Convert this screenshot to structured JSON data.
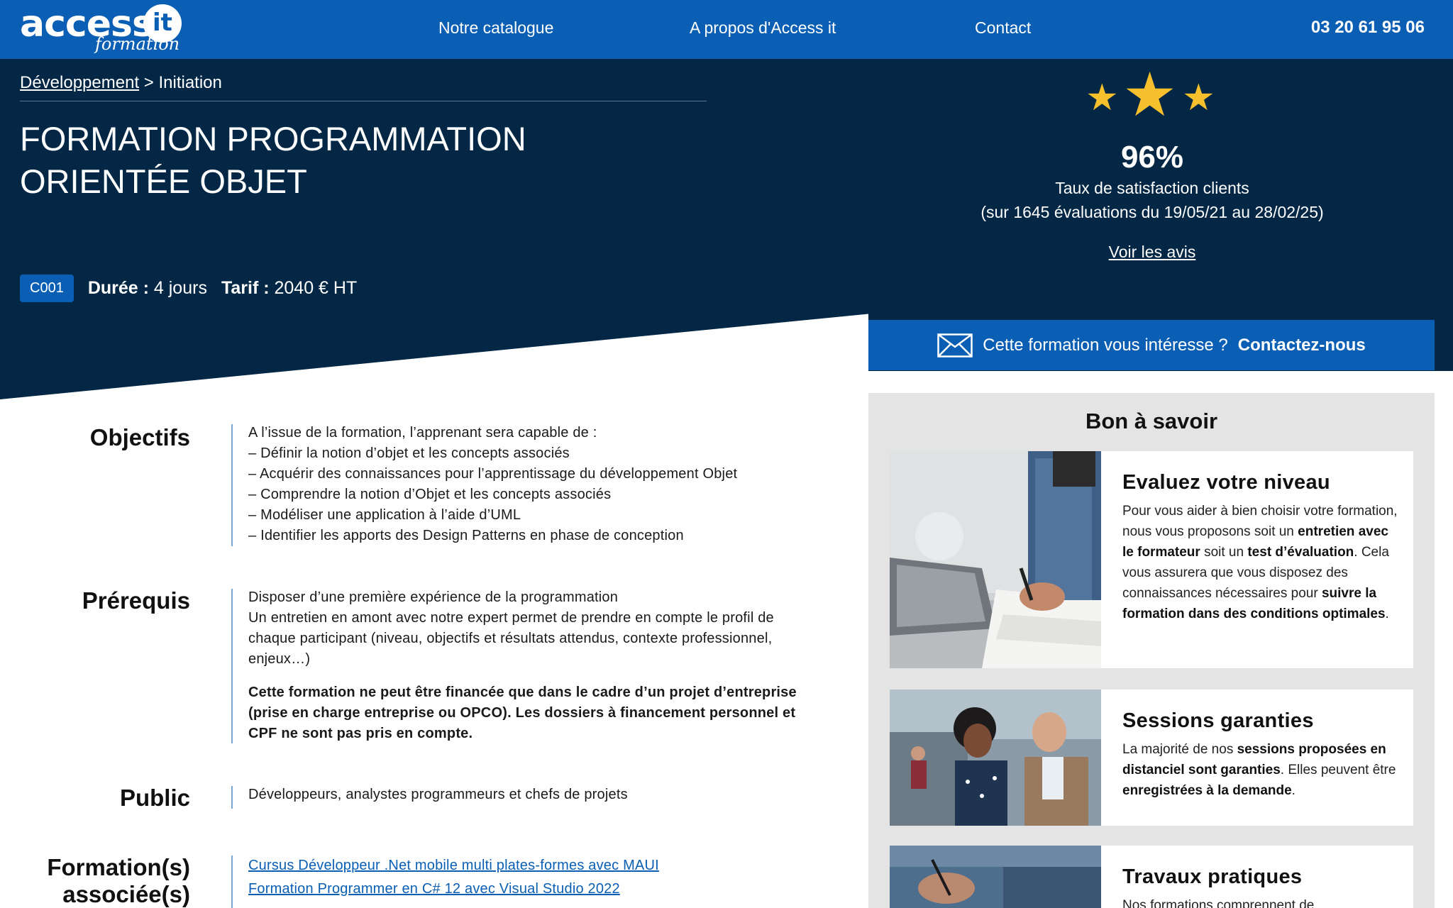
{
  "header": {
    "logo_text": "access",
    "logo_it": "it",
    "logo_sub": "formation",
    "nav": [
      "Notre catalogue",
      "A propos d'Access it",
      "Contact"
    ],
    "phone": "03 20 61 95 06"
  },
  "breadcrumb": {
    "parent": "Développement",
    "separator": ">",
    "current": "Initiation"
  },
  "course": {
    "title": "FORMATION PROGRAMMATION ORIENTÉE OBJET",
    "code": "C001",
    "duration_label": "Durée :",
    "duration_value": "4 jours",
    "price_label": "Tarif :",
    "price_value": "2040 € HT"
  },
  "rating": {
    "percent": "96%",
    "label": "Taux de satisfaction clients",
    "sub": "(sur 1645 évaluations du 19/05/21 au 28/02/25)",
    "link": "Voir les avis",
    "star_count": 3
  },
  "contact_cta": {
    "text": "Cette formation vous intéresse ?",
    "strong": "Contactez-nous"
  },
  "sections": {
    "objectifs": {
      "title": "Objectifs",
      "intro": "A l’issue de la formation, l’apprenant sera capable de :",
      "items": [
        "– Définir la notion d’objet et les concepts associés",
        "– Acquérir des connaissances pour l’apprentissage du développement Objet",
        "– Comprendre la notion d’Objet et les concepts associés",
        "– Modéliser une application à l’aide d’UML",
        "– Identifier les apports des Design Patterns en phase de conception"
      ]
    },
    "prerequis": {
      "title": "Prérequis",
      "line1": "Disposer d’une première expérience de la programmation",
      "line2": "Un entretien en amont avec notre expert permet de prendre en compte le profil de chaque participant (niveau, objectifs et résultats attendus, contexte professionnel, enjeux…)",
      "notice": "Cette formation ne peut être financée que dans le cadre d’un projet d’entreprise (prise en charge entreprise ou OPCO). Les dossiers à financement personnel et CPF ne sont pas pris en compte."
    },
    "public": {
      "title": "Public",
      "text": "Développeurs, analystes programmeurs et chefs de projets"
    },
    "associees": {
      "title_line1": "Formation(s)",
      "title_line2": "associée(s)",
      "links": [
        "Cursus Développeur .Net mobile multi plates-formes avec MAUI",
        "Formation Programmer en C# 12 avec Visual Studio 2022"
      ]
    }
  },
  "panel": {
    "title": "Bon à savoir",
    "cards": [
      {
        "title": "Evaluez votre niveau",
        "p1": "Pour vous aider à bien choisir votre formation, nous vous proposons soit un ",
        "b1": "entretien avec le formateur",
        "p2": " soit un ",
        "b2": "test d’évaluation",
        "p3": ". Cela vous assurera que vous disposez des connaissances nécessaires pour ",
        "b3": "suivre la formation dans des conditions optimales",
        "p4": "."
      },
      {
        "title": "Sessions garanties",
        "p1": "La majorité de nos ",
        "b1": "sessions proposées en distanciel sont garanties",
        "p2": ". Elles peuvent être ",
        "b2": "enregistrées à la demande",
        "p3": "."
      },
      {
        "title": "Travaux pratiques",
        "p1": "Nos formations comprennent de"
      }
    ]
  },
  "colors": {
    "brand_blue": "#0a5fb5",
    "hero_navy": "#032745",
    "star": "#f5c02b",
    "panel_bg": "#e4e4e4"
  }
}
